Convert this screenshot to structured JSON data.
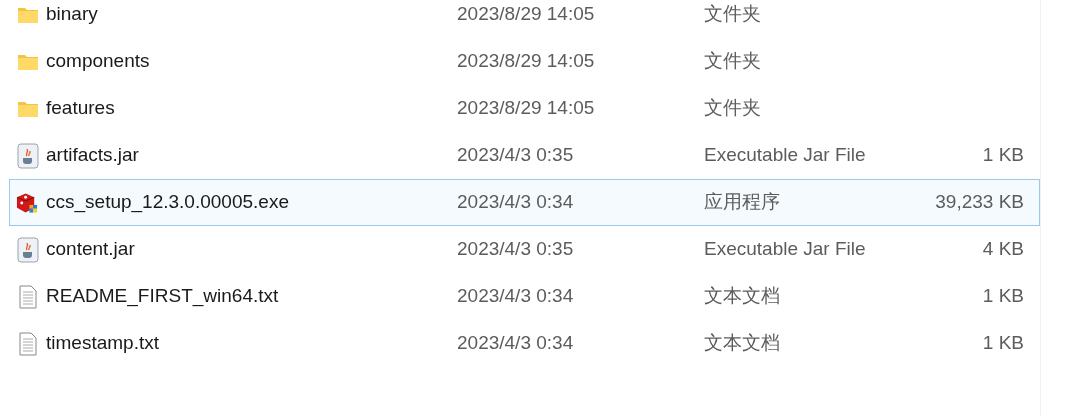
{
  "files": [
    {
      "kind": "folder",
      "name": "binary",
      "modified": "2023/8/29 14:05",
      "type": "文件夹",
      "hovered": false
    },
    {
      "kind": "folder",
      "name": "components",
      "modified": "2023/8/29 14:05",
      "type": "文件夹",
      "hovered": false
    },
    {
      "kind": "folder",
      "name": "features",
      "modified": "2023/8/29 14:05",
      "type": "文件夹",
      "hovered": false
    },
    {
      "kind": "jar",
      "name": "artifacts.jar",
      "modified": "2023/4/3 0:35",
      "type": "Executable Jar File",
      "size": "1 KB",
      "hovered": false
    },
    {
      "kind": "exe",
      "name": "ccs_setup_12.3.0.00005.exe",
      "modified": "2023/4/3 0:34",
      "type": "应用程序",
      "size": "39,233 KB",
      "hovered": true
    },
    {
      "kind": "jar",
      "name": "content.jar",
      "modified": "2023/4/3 0:35",
      "type": "Executable Jar File",
      "size": "4 KB",
      "hovered": false
    },
    {
      "kind": "txt",
      "name": "README_FIRST_win64.txt",
      "modified": "2023/4/3 0:34",
      "type": "文本文档",
      "size": "1 KB",
      "hovered": false
    },
    {
      "kind": "txt",
      "name": "timestamp.txt",
      "modified": "2023/4/3 0:34",
      "type": "文本文档",
      "size": "1 KB",
      "hovered": false
    }
  ]
}
